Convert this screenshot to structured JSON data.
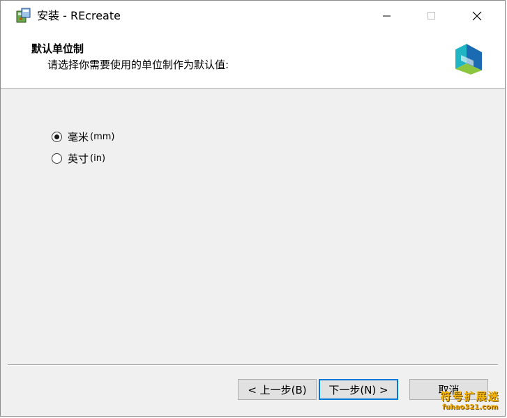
{
  "window": {
    "title": "安装 - REcreate"
  },
  "header": {
    "title": "默认单位制",
    "subtitle": "请选择你需要使用的单位制作为默认值:"
  },
  "options": [
    {
      "label": "毫米",
      "unit": "(mm)",
      "checked": true
    },
    {
      "label": "英寸",
      "unit": "(in)",
      "checked": false
    }
  ],
  "buttons": {
    "back": "< 上一步(B)",
    "next": "下一步(N) >",
    "cancel": "取消"
  },
  "watermark": {
    "line1": "符号扩展迷",
    "line2": "fuhao321.com"
  },
  "colors": {
    "accent": "#0078d7",
    "logo_teal": "#1fb5c4",
    "logo_green": "#8cc63f",
    "logo_blue": "#1b6bb3"
  },
  "icons": {
    "app": "installer-icon",
    "brand": "hexagon-logo-icon"
  }
}
